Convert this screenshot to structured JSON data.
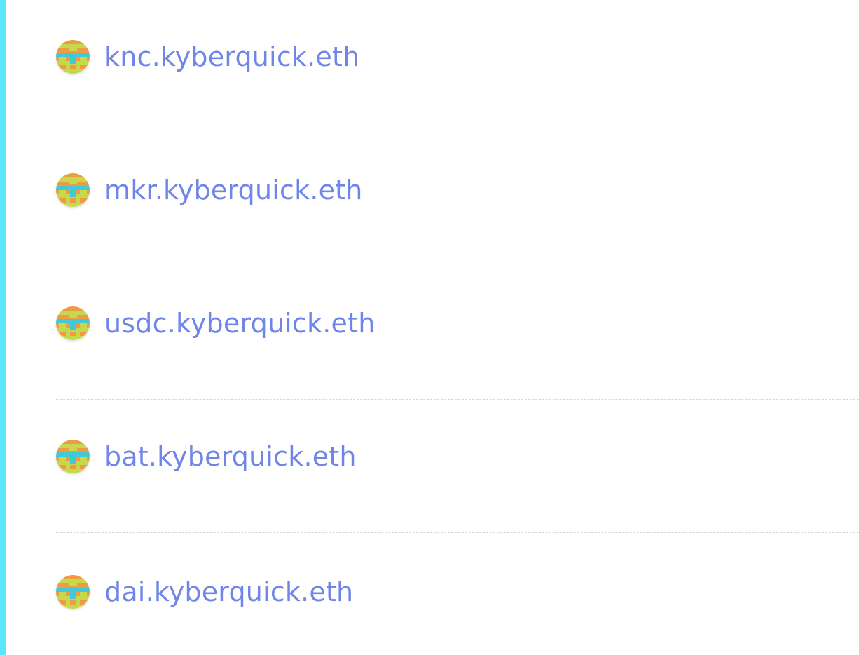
{
  "colors": {
    "accent_bar": "#5ae6ff",
    "link": "#6f86e8",
    "divider": "#d6d6d6",
    "avatar_orange": "#ef9b46",
    "avatar_green": "#c6d84b",
    "avatar_cyan": "#42c9d6"
  },
  "names": [
    {
      "label": "knc.kyberquick.eth",
      "icon": "identicon-avatar-icon"
    },
    {
      "label": "mkr.kyberquick.eth",
      "icon": "identicon-avatar-icon"
    },
    {
      "label": "usdc.kyberquick.eth",
      "icon": "identicon-avatar-icon"
    },
    {
      "label": "bat.kyberquick.eth",
      "icon": "identicon-avatar-icon"
    },
    {
      "label": "dai.kyberquick.eth",
      "icon": "identicon-avatar-icon"
    }
  ]
}
